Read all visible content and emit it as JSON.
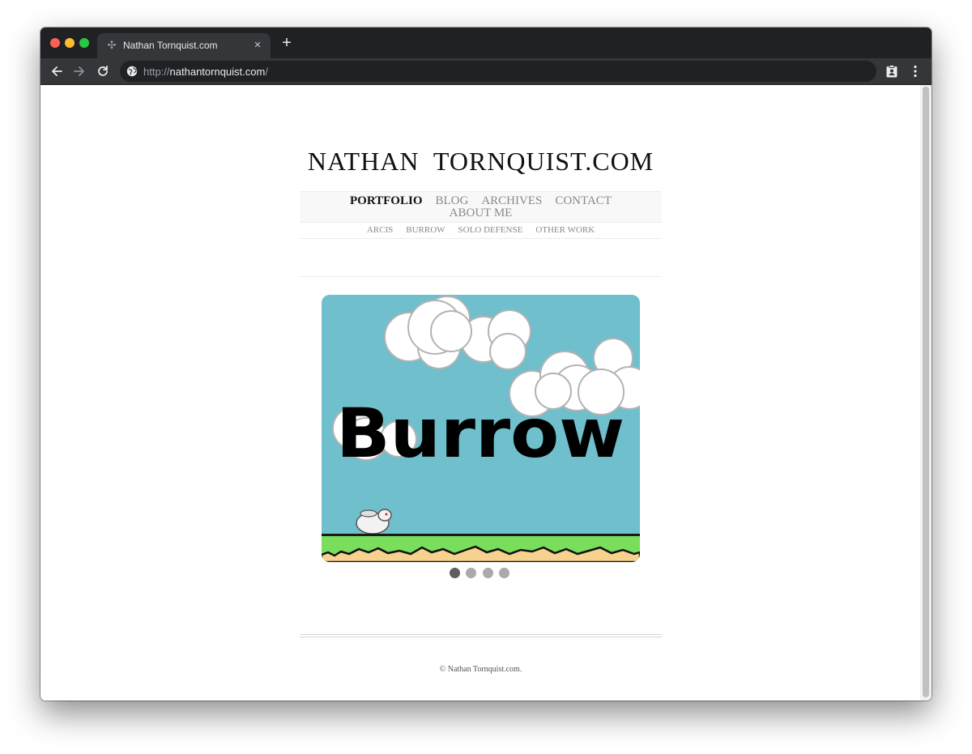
{
  "browser": {
    "tab_title": "Nathan Tornquist.com",
    "tab_close_label": "×",
    "new_tab_label": "+",
    "url_scheme": "http://",
    "url_host": "nathantornquist.com",
    "url_path": "/"
  },
  "site": {
    "title": "NATHAN  TORNQUIST.COM",
    "nav_primary": [
      {
        "label": "PORTFOLIO",
        "active": true
      },
      {
        "label": "BLOG"
      },
      {
        "label": "ARCHIVES"
      },
      {
        "label": "CONTACT"
      },
      {
        "label": "ABOUT ME"
      }
    ],
    "nav_sub": [
      "ARCIS",
      "BURROW",
      "SOLO DEFENSE",
      "OTHER WORK"
    ],
    "slideshow": {
      "slide_text": "Burrow",
      "slide_count": 4,
      "active_index": 0,
      "colors": {
        "sky": "#6fbfcd",
        "grass": "#79de5c",
        "dirt": "#f6d28e"
      }
    },
    "copyright": "© Nathan Tornquist.com."
  }
}
